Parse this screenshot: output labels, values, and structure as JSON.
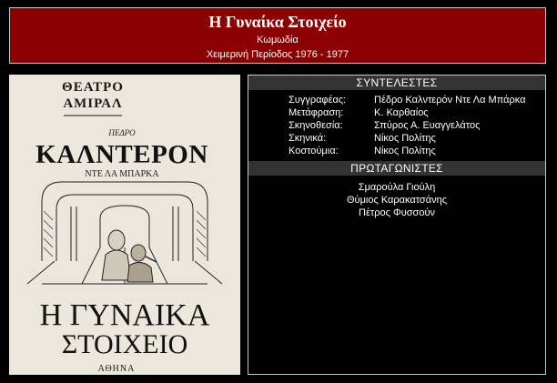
{
  "header": {
    "title": "Η Γυναίκα Στοιχείο",
    "genre": "Κωμωδία",
    "season": "Χειμερινή Περίοδος 1976 - 1977"
  },
  "poster": {
    "theatre_line1": "ΘΕΑΤΡΟ",
    "theatre_line2": "ΑΜΙΡΑΛ",
    "author_first": "ΠΕΔΡΟ",
    "author_last": "ΚΑΛΝΤΕΡΟΝ",
    "author_suffix": "ΝΤΕ ΛΑ ΜΠΑΡΚΑ",
    "title_line1": "Η ΓΥΝΑΙΚΑ",
    "title_line2": "ΣΤΟΙΧΕΙΟ",
    "city": "ΑΘΗΝΑ"
  },
  "credits_section": {
    "heading": "ΣΥΝΤΕΛΕΣΤΕΣ",
    "rows": [
      {
        "label": "Συγγραφέας:",
        "value": "Πέδρο Καλντερόν Ντε Λα Μπάρκα"
      },
      {
        "label": "Μετάφραση:",
        "value": "Κ. Καρθαίος"
      },
      {
        "label": "Σκηνοθεσία:",
        "value": "Σπύρος Α. Ευαγγελάτος"
      },
      {
        "label": "Σκηνικά:",
        "value": "Νίκος Πολίτης"
      },
      {
        "label": "Κοστούμια:",
        "value": "Νίκος Πολίτης"
      }
    ]
  },
  "cast_section": {
    "heading": "ΠΡΩΤΑΓΩΝΙΣΤΕΣ",
    "members": [
      "Σμαρούλα Γιούλη",
      "Θύμιος Καρακατσάνης",
      "Πέτρος Φυσσούν"
    ]
  },
  "colors": {
    "header_bg": "#8b0000",
    "section_head_bg": "#333333",
    "page_bg": "#000000",
    "border": "#c9c9c9"
  }
}
